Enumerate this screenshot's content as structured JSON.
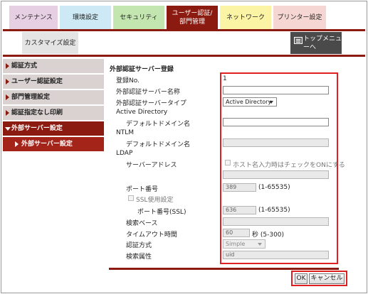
{
  "tabs": [
    {
      "label": "メンテナンス",
      "bg": "#e7cfe3"
    },
    {
      "label": "環境設定",
      "bg": "#cde9f5"
    },
    {
      "label": "セキュリティ",
      "bg": "#c3e6b0"
    },
    {
      "label": "ユーザー認証/部門管理",
      "bg": "#8b1b10"
    },
    {
      "label": "ネットワーク",
      "bg": "#fbf4a4"
    },
    {
      "label": "プリンター設定",
      "bg": "#f6d6d2"
    },
    {
      "label": "カスタマイズ設定",
      "bg": "#e4e4e4"
    }
  ],
  "top_menu_label": "トップメニューへ",
  "sidebar": {
    "items": [
      {
        "label": "認証方式"
      },
      {
        "label": "ユーザー認証設定"
      },
      {
        "label": "部門管理設定"
      },
      {
        "label": "認証指定なし印刷"
      },
      {
        "label": "外部サーバー設定"
      }
    ],
    "sub_item": "外部サーバー設定"
  },
  "form": {
    "title": "外部認証サーバー登録",
    "reg_no_label": "登録No.",
    "reg_no_value": "1",
    "server_name_label": "外部認証サーバー名称",
    "server_name_value": "",
    "server_type_label": "外部認証サーバータイプ",
    "server_type_value": "Active Directory",
    "ad_label": "Active Directory",
    "ad_domain_label": "デフォルトドメイン名",
    "ad_domain_value": "",
    "ntlm_label": "NTLM",
    "ntlm_domain_label": "デフォルトドメイン名",
    "ntlm_domain_value": "",
    "ldap_label": "LDAP",
    "server_address_label": "サーバーアドレス",
    "hostname_check_label": "ホスト名入力時はチェックをONにする",
    "server_address_value": "",
    "port_label": "ポート番号",
    "port_value": "389",
    "port_range": "(1-65535)",
    "ssl_label": "SSL使用設定",
    "ssl_port_label": "ポート番号(SSL)",
    "ssl_port_value": "636",
    "ssl_port_range": "(1-65535)",
    "search_base_label": "検索ベース",
    "search_base_value": "",
    "timeout_label": "タイムアウト時間",
    "timeout_value": "60",
    "timeout_unit": "秒 (5-300)",
    "auth_method_label": "認証方式",
    "auth_method_value": "Simple",
    "search_attr_label": "検索属性",
    "search_attr_value": "uid"
  },
  "buttons": {
    "ok": "OK",
    "cancel": "キャンセル"
  },
  "colors": {
    "accent": "#8b1b10",
    "highlight_box": "#e02020"
  }
}
